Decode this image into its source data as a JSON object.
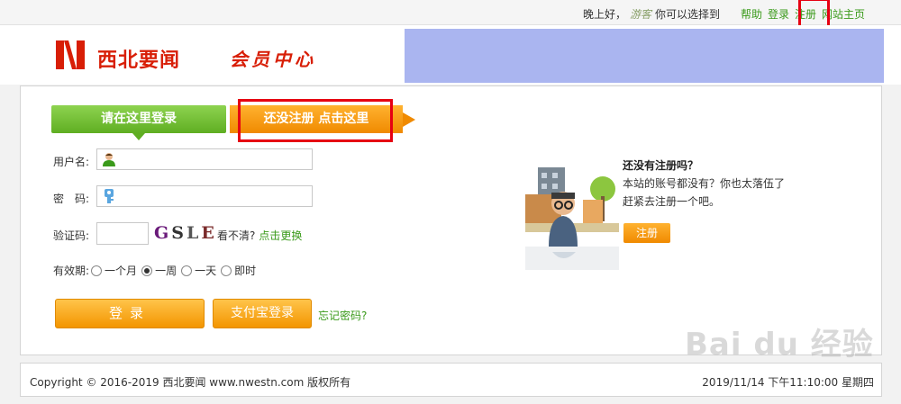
{
  "topbar": {
    "greeting": "晚上好，",
    "guest": "游客",
    "choose": "你可以选择到",
    "links": [
      "帮助",
      "登录",
      "注册",
      "网站主页"
    ]
  },
  "header": {
    "site_name": "西北要闻",
    "member_center": "会员中心"
  },
  "tabs": {
    "login": "请在这里登录",
    "register": "还没注册 点击这里"
  },
  "form": {
    "username_label": "用户名:",
    "password_label": "密　码:",
    "captcha_label": "验证码:",
    "captcha_chars": [
      "G",
      "S",
      "L",
      "E"
    ],
    "cant_see": "看不清?",
    "change": "点击更换",
    "validity_label": "有效期:",
    "validity_options": [
      "一个月",
      "一周",
      "一天",
      "即时"
    ],
    "validity_selected": "一周",
    "login_button": "登录",
    "alipay_button": "支付宝登录",
    "forgot": "忘记密码?"
  },
  "register_promo": {
    "title": "还没有注册吗？",
    "line1": "本站的账号都没有？你也太落伍了",
    "line2": "赶紧去注册一个吧。",
    "button": "注册"
  },
  "footer": {
    "copyright": "Copyright © 2016-2019 西北要闻 www.nwestn.com 版权所有",
    "datetime": "2019/11/14 下午11:10:00 星期四"
  },
  "watermark": "Bai du 经验",
  "colors": {
    "accent_green": "#5fae22",
    "accent_orange": "#f08a00",
    "brand_red": "#d81e06",
    "highlight_red": "#e60012",
    "banner_blue": "#aab5f0"
  }
}
